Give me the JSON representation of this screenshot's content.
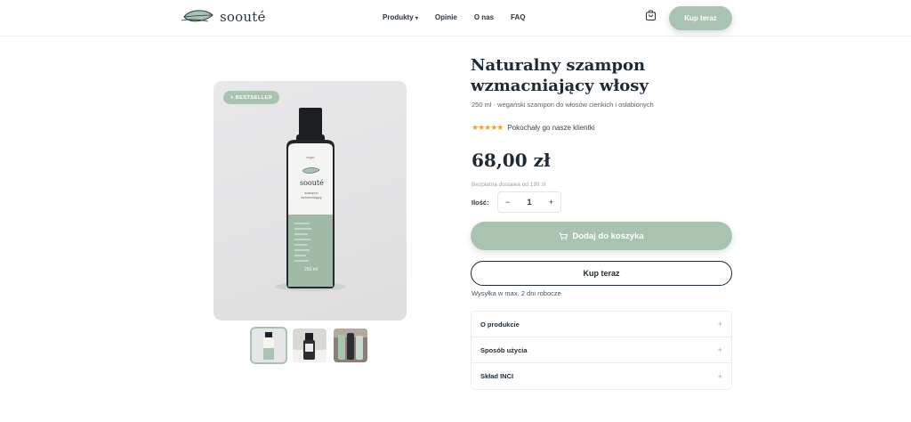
{
  "header": {
    "logo_text": "soouté",
    "nav": [
      "Produkty",
      "Opinie",
      "O nas",
      "FAQ"
    ],
    "cta_label": "Kup teraz"
  },
  "gallery": {
    "badge": "+ BESTSELLER",
    "bottle_brand": "soouté",
    "bottle_tag": "vegan",
    "bottle_desc_1": "szampon",
    "bottle_desc_2": "wzmacniający",
    "bottle_volume": "250 ml",
    "thumbnail_count": 3
  },
  "product": {
    "title": "Naturalny szampon wzmacniający włosy",
    "subtitle": "250 ml · wegański szampon do włosów cienkich i osłabionych",
    "stars": "★★★★★",
    "rating_text": "Pokochały go nasze klientki",
    "price": "68,00 zł",
    "shipping_note": "Bezpłatna dostawa od 199 zł",
    "qty_label": "Ilość:",
    "qty_minus": "−",
    "qty_value": "1",
    "qty_plus": "+",
    "add_to_cart": "Dodaj do koszyka",
    "buy_now": "Kup teraz",
    "delivery_time": "Wysyłka w max. 2 dni robocze"
  },
  "accordion": [
    {
      "label": "O produkcie"
    },
    {
      "label": "Sposób użycia"
    },
    {
      "label": "Skład INCI"
    }
  ],
  "colors": {
    "accent": "#a9c3b1",
    "dark": "#1e2a35",
    "star": "#e8a23a"
  }
}
